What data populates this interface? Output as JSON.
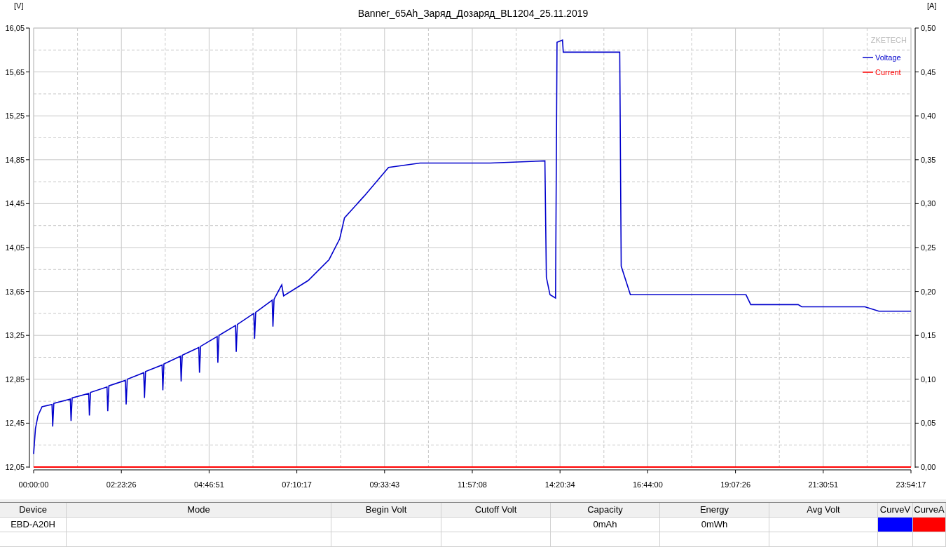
{
  "chart": {
    "unit_left": "[V]",
    "unit_right": "[A]",
    "watermark": "ZKETECH",
    "chart_data": {
      "type": "line",
      "title": "Banner_65Ah_Заряд_Дозаряд_BL1204_25.11.2019",
      "x": [
        0,
        180,
        432,
        828,
        1800,
        1872,
        1980,
        3600,
        3672,
        3780,
        5400,
        5472,
        5580,
        7200,
        7272,
        7380,
        9000,
        9072,
        9180,
        10800,
        10872,
        10980,
        12600,
        12672,
        12780,
        14400,
        14472,
        14580,
        16200,
        16272,
        16380,
        18000,
        18072,
        18180,
        19800,
        19872,
        19980,
        21600,
        21672,
        21780,
        23400,
        23472,
        23580,
        24048,
        24336,
        24516,
        26928,
        28980,
        30024,
        30492,
        32436,
        34812,
        37908,
        44784,
        50148,
        50292,
        50652,
        51192,
        51336,
        51876,
        51948,
        57492,
        57636,
        58536,
        69876,
        70344,
        74988,
        75348,
        81540,
        82908,
        86057
      ],
      "series": [
        {
          "name": "Voltage",
          "color": "#0000cc",
          "values": [
            12.17,
            12.4,
            12.52,
            12.6,
            12.62,
            12.42,
            12.63,
            12.67,
            12.47,
            12.68,
            12.72,
            12.52,
            12.73,
            12.78,
            12.56,
            12.79,
            12.84,
            12.62,
            12.85,
            12.91,
            12.68,
            12.92,
            12.98,
            12.75,
            12.99,
            13.06,
            12.83,
            13.07,
            13.14,
            12.91,
            13.15,
            13.24,
            13.0,
            13.25,
            13.34,
            13.1,
            13.35,
            13.45,
            13.22,
            13.46,
            13.57,
            13.33,
            13.58,
            13.66,
            13.71,
            13.61,
            13.75,
            13.94,
            14.13,
            14.32,
            14.52,
            14.78,
            14.82,
            14.82,
            14.84,
            13.78,
            13.62,
            13.59,
            15.92,
            15.94,
            15.83,
            15.83,
            13.88,
            13.62,
            13.62,
            13.53,
            13.53,
            13.51,
            13.51,
            13.47,
            13.47
          ]
        },
        {
          "name": "Current",
          "color": "#ff0000",
          "axis": "y2",
          "values": [
            0,
            0,
            0,
            0,
            0,
            0,
            0,
            0,
            0,
            0,
            0,
            0,
            0,
            0,
            0,
            0,
            0,
            0,
            0,
            0,
            0,
            0,
            0,
            0,
            0,
            0,
            0,
            0,
            0,
            0,
            0,
            0,
            0,
            0,
            0,
            0,
            0,
            0,
            0,
            0,
            0,
            0,
            0,
            0,
            0,
            0,
            0,
            0,
            0,
            0,
            0,
            0,
            0,
            0,
            0,
            0,
            0,
            0,
            0,
            0,
            0,
            0,
            0,
            0,
            0,
            0,
            0,
            0,
            0,
            0,
            0
          ]
        }
      ],
      "grid": true,
      "legend": true,
      "xlim": [
        0,
        86057
      ],
      "ylim": [
        12.05,
        16.05
      ],
      "y2lim": [
        0,
        0.5
      ],
      "xticks": [
        {
          "value": 0,
          "label": "00:00:00"
        },
        {
          "value": 8606,
          "label": "02:23:26"
        },
        {
          "value": 17211,
          "label": "04:46:51"
        },
        {
          "value": 25817,
          "label": "07:10:17"
        },
        {
          "value": 34423,
          "label": "09:33:43"
        },
        {
          "value": 43028,
          "label": "11:57:08"
        },
        {
          "value": 51634,
          "label": "14:20:34"
        },
        {
          "value": 60240,
          "label": "16:44:00"
        },
        {
          "value": 68846,
          "label": "19:07:26"
        },
        {
          "value": 77451,
          "label": "21:30:51"
        },
        {
          "value": 86057,
          "label": "23:54:17"
        }
      ],
      "yticks": [
        {
          "value": 12.05,
          "label": "12,05"
        },
        {
          "value": 12.45,
          "label": "12,45"
        },
        {
          "value": 12.85,
          "label": "12,85"
        },
        {
          "value": 13.25,
          "label": "13,25"
        },
        {
          "value": 13.65,
          "label": "13,65"
        },
        {
          "value": 14.05,
          "label": "14,05"
        },
        {
          "value": 14.45,
          "label": "14,45"
        },
        {
          "value": 14.85,
          "label": "14,85"
        },
        {
          "value": 15.25,
          "label": "15,25"
        },
        {
          "value": 15.65,
          "label": "15,65"
        },
        {
          "value": 16.05,
          "label": "16,05"
        }
      ],
      "y2ticks": [
        {
          "value": 0,
          "label": "0,00"
        },
        {
          "value": 0.05,
          "label": "0,05"
        },
        {
          "value": 0.1,
          "label": "0,10"
        },
        {
          "value": 0.15,
          "label": "0,15"
        },
        {
          "value": 0.2,
          "label": "0,20"
        },
        {
          "value": 0.25,
          "label": "0,25"
        },
        {
          "value": 0.3,
          "label": "0,30"
        },
        {
          "value": 0.35,
          "label": "0,35"
        },
        {
          "value": 0.4,
          "label": "0,40"
        },
        {
          "value": 0.45,
          "label": "0,45"
        },
        {
          "value": 0.5,
          "label": "0,50"
        }
      ]
    }
  },
  "table": {
    "columns": [
      {
        "label": "Device",
        "kind": "text"
      },
      {
        "label": "Mode",
        "kind": "text"
      },
      {
        "label": "Begin Volt",
        "kind": "text"
      },
      {
        "label": "Cutoff Volt",
        "kind": "text"
      },
      {
        "label": "Capacity",
        "kind": "text"
      },
      {
        "label": "Energy",
        "kind": "text"
      },
      {
        "label": "Avg Volt",
        "kind": "text"
      },
      {
        "label": "CurveV",
        "kind": "swatch"
      },
      {
        "label": "CurveA",
        "kind": "swatch"
      }
    ],
    "rows": [
      {
        "cells": [
          "EBD-A20H",
          null,
          null,
          null,
          "0mAh",
          "0mWh",
          null,
          {
            "color": "#0000ff"
          },
          {
            "color": "#ff0000"
          }
        ]
      }
    ]
  }
}
